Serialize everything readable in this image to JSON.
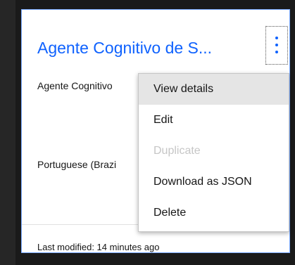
{
  "card": {
    "title": "Agente Cognitivo de S...",
    "description": "Agente Cognitivo",
    "language": "Portuguese (Brazi",
    "footer": "Last modified: 14 minutes ago"
  },
  "overflow_menu": {
    "trigger_icon": "kebab-vertical-icon",
    "items": [
      {
        "label": "View details",
        "state": "hover"
      },
      {
        "label": "Edit",
        "state": "enabled"
      },
      {
        "label": "Duplicate",
        "state": "disabled"
      },
      {
        "label": "Download as JSON",
        "state": "enabled"
      },
      {
        "label": "Delete",
        "state": "enabled"
      }
    ]
  },
  "colors": {
    "accent": "#0f62fe",
    "card_border": "#78a9ff",
    "background": "#1a1a1a",
    "menu_hover": "#e5e5e5",
    "disabled_text": "#c6c6c6"
  }
}
